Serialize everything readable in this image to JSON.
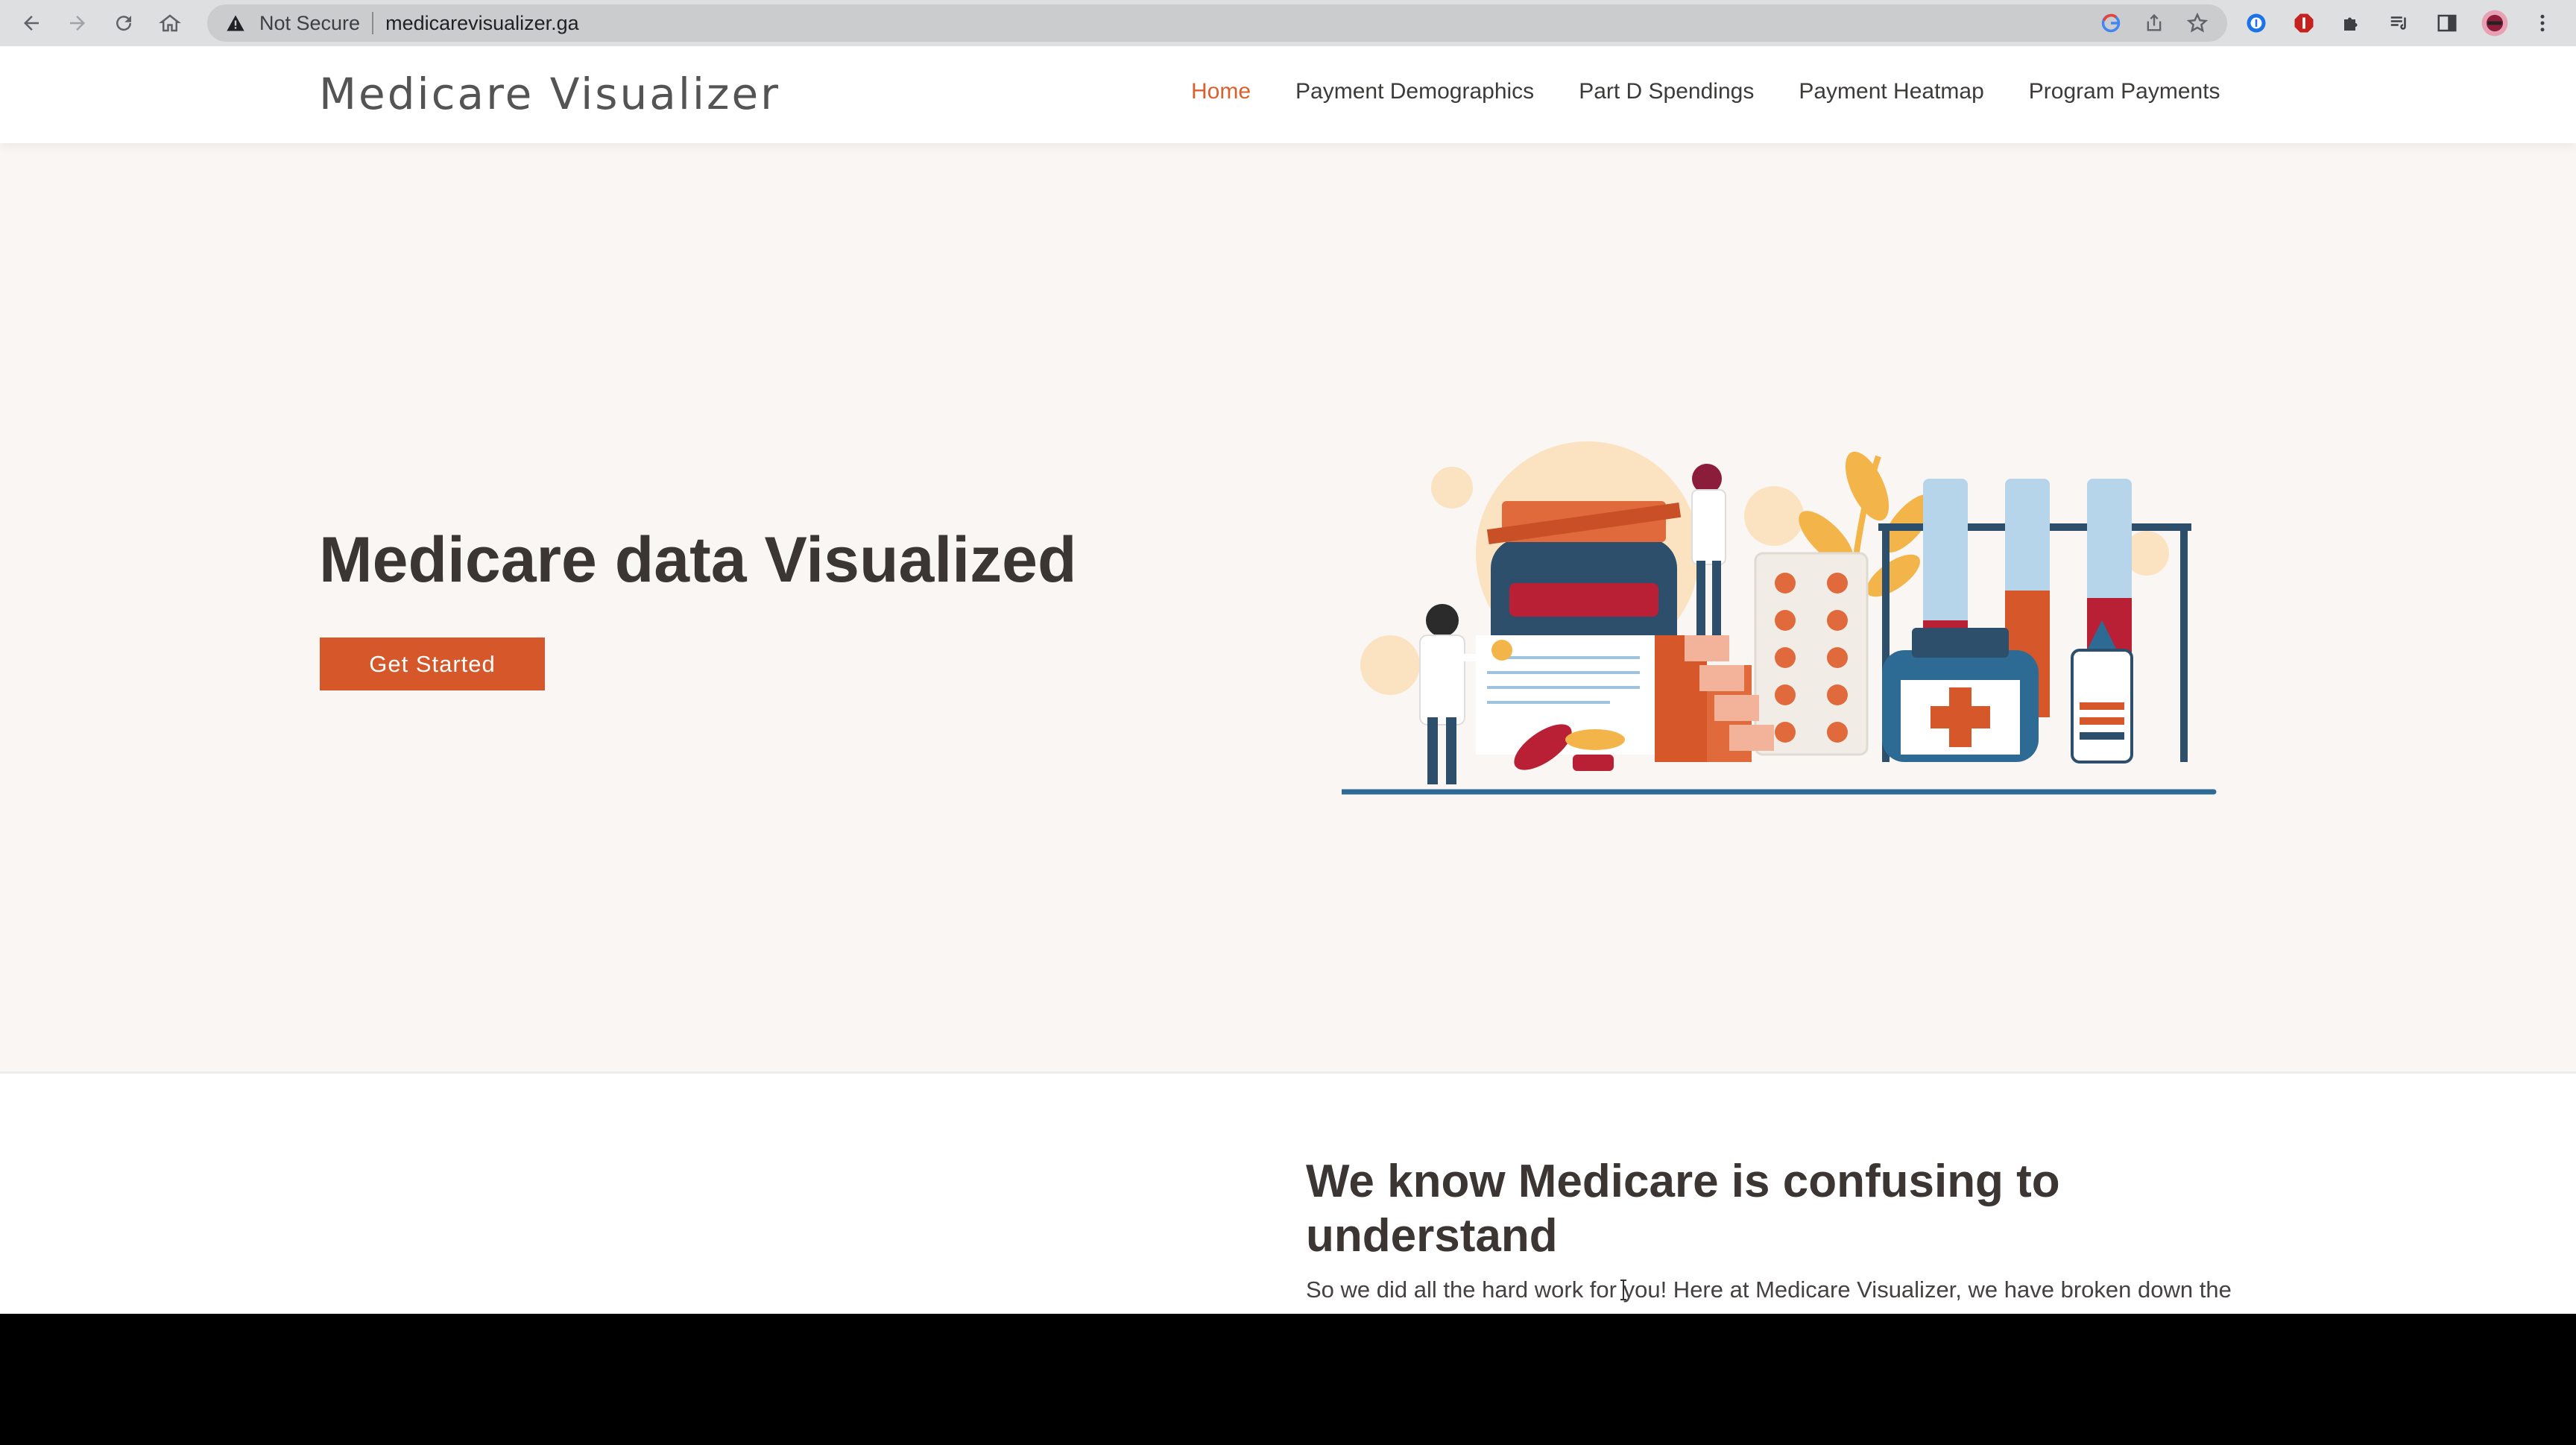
{
  "browser": {
    "security_label": "Not Secure",
    "url": "medicarevisualizer.ga"
  },
  "site": {
    "brand": "Medicare Visualizer",
    "nav": [
      {
        "label": "Home",
        "active": true
      },
      {
        "label": "Payment Demographics",
        "active": false
      },
      {
        "label": "Part D Spendings",
        "active": false
      },
      {
        "label": "Payment Heatmap",
        "active": false
      },
      {
        "label": "Program Payments",
        "active": false
      }
    ]
  },
  "hero": {
    "title": "Medicare data Visualized",
    "cta_label": "Get Started"
  },
  "about": {
    "title": "We know Medicare is confusing to understand",
    "body": "So we did all the hard work for you! Here at Medicare Visualizer, we have broken down the"
  },
  "colors": {
    "accent": "#d5572a",
    "nav_active": "#d8612e",
    "heading": "#3b3533",
    "page_bg": "#f9f6f3"
  },
  "icons": {
    "back": "arrow-left-icon",
    "forward": "arrow-right-icon",
    "reload": "reload-icon",
    "home": "home-icon",
    "warning": "warning-triangle-icon",
    "google": "google-icon",
    "share": "share-icon",
    "bookmark": "star-icon",
    "extensions": "puzzle-icon",
    "media": "media-controls-icon",
    "sidepanel": "side-panel-icon",
    "profile": "avatar",
    "menu": "kebab-menu-icon"
  }
}
